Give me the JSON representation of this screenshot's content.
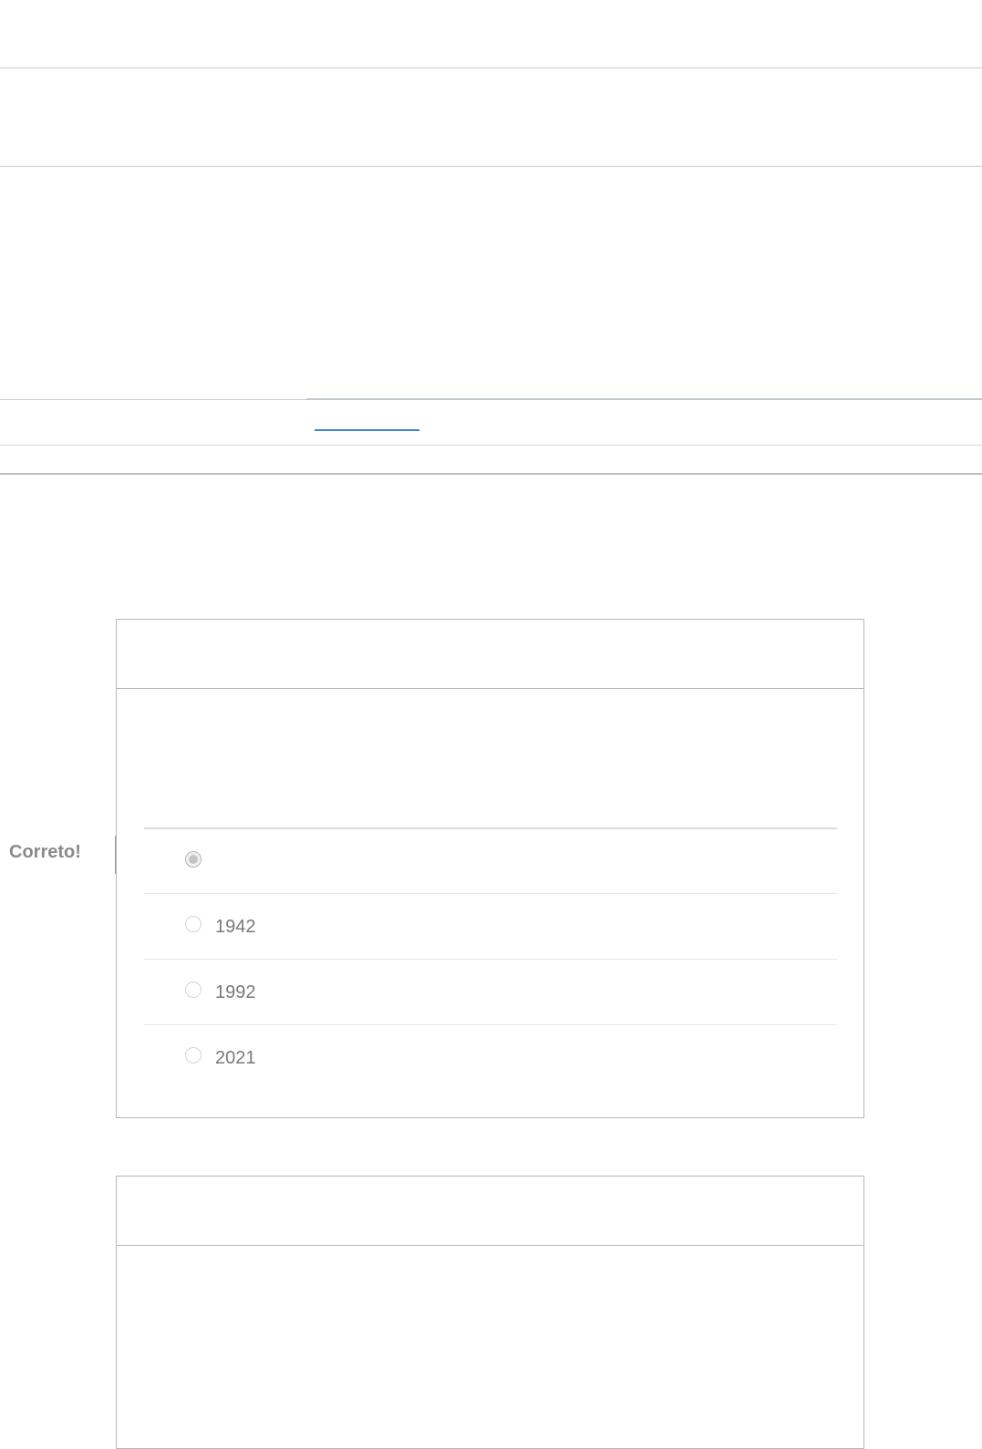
{
  "quiz": {
    "question_1": {
      "correct_label": "Correto!",
      "answers": [
        {
          "label": "",
          "selected": true
        },
        {
          "label": "1942",
          "selected": false
        },
        {
          "label": "1992",
          "selected": false
        },
        {
          "label": "2021",
          "selected": false
        }
      ]
    }
  }
}
